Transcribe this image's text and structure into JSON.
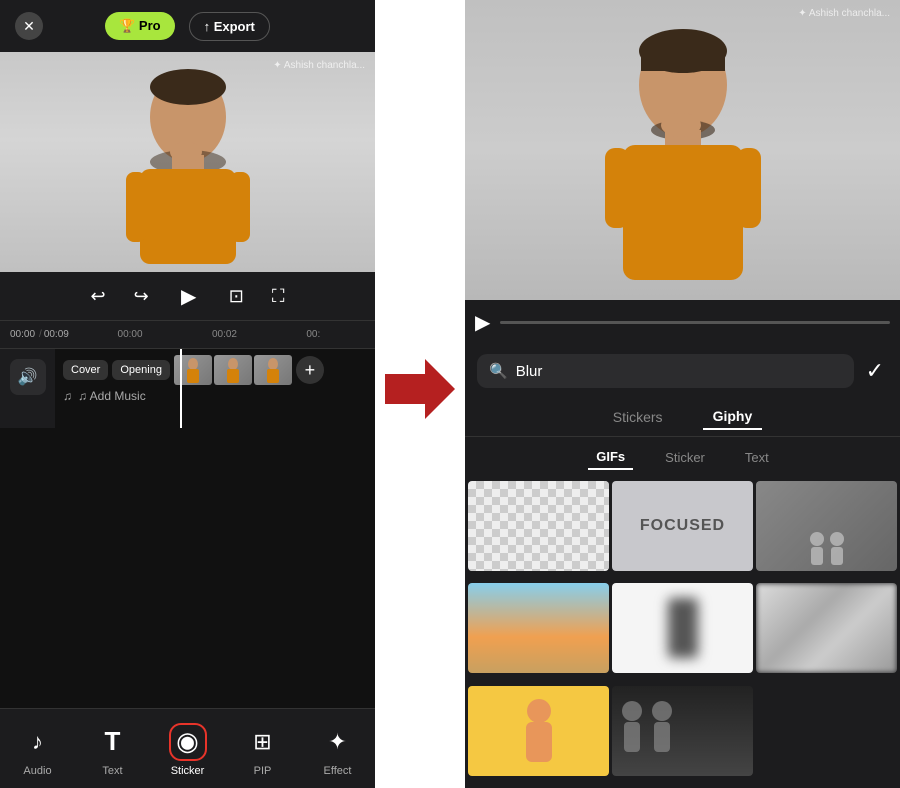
{
  "left_panel": {
    "top_bar": {
      "close_label": "✕",
      "pro_label": "🏆 Pro",
      "export_label": "↑ Export"
    },
    "watermark": "✦ Ashish chanchla...",
    "timeline": {
      "current_time": "00:00",
      "total_time": "00:09",
      "ruler_marks": [
        "00:00",
        "00:02",
        "00:0"
      ]
    },
    "track_labels": {
      "cover": "Cover",
      "opening": "Opening",
      "add_music": "♫ Add Music"
    },
    "toolbar": {
      "items": [
        {
          "id": "audio",
          "label": "Audio",
          "icon": "♪"
        },
        {
          "id": "text",
          "label": "Text",
          "icon": "T"
        },
        {
          "id": "sticker",
          "label": "Sticker",
          "icon": "◉",
          "active": true
        },
        {
          "id": "pip",
          "label": "PIP",
          "icon": "⊞"
        },
        {
          "id": "effect",
          "label": "Effect",
          "icon": "✦"
        }
      ]
    }
  },
  "arrow": {
    "symbol": "➤"
  },
  "right_panel": {
    "watermark": "✦ Ashish chanchla...",
    "search": {
      "placeholder": "Blur",
      "value": "Blur"
    },
    "tabs_top": [
      {
        "id": "stickers",
        "label": "Stickers",
        "active": false
      },
      {
        "id": "giphy",
        "label": "Giphy",
        "active": true
      }
    ],
    "tabs_sub": [
      {
        "id": "gifs",
        "label": "GIFs",
        "active": true
      },
      {
        "id": "sticker",
        "label": "Sticker",
        "active": false
      },
      {
        "id": "text",
        "label": "Text",
        "active": false
      }
    ],
    "gif_grid": [
      {
        "id": "cell1",
        "type": "checkerboard"
      },
      {
        "id": "cell2",
        "type": "focused"
      },
      {
        "id": "cell3",
        "type": "people_dark"
      },
      {
        "id": "cell4",
        "type": "beach"
      },
      {
        "id": "cell5",
        "type": "blur_figure"
      },
      {
        "id": "cell6",
        "type": "pixelated"
      },
      {
        "id": "cell7",
        "type": "yellow_person"
      },
      {
        "id": "cell8",
        "type": "dark_people"
      }
    ]
  }
}
